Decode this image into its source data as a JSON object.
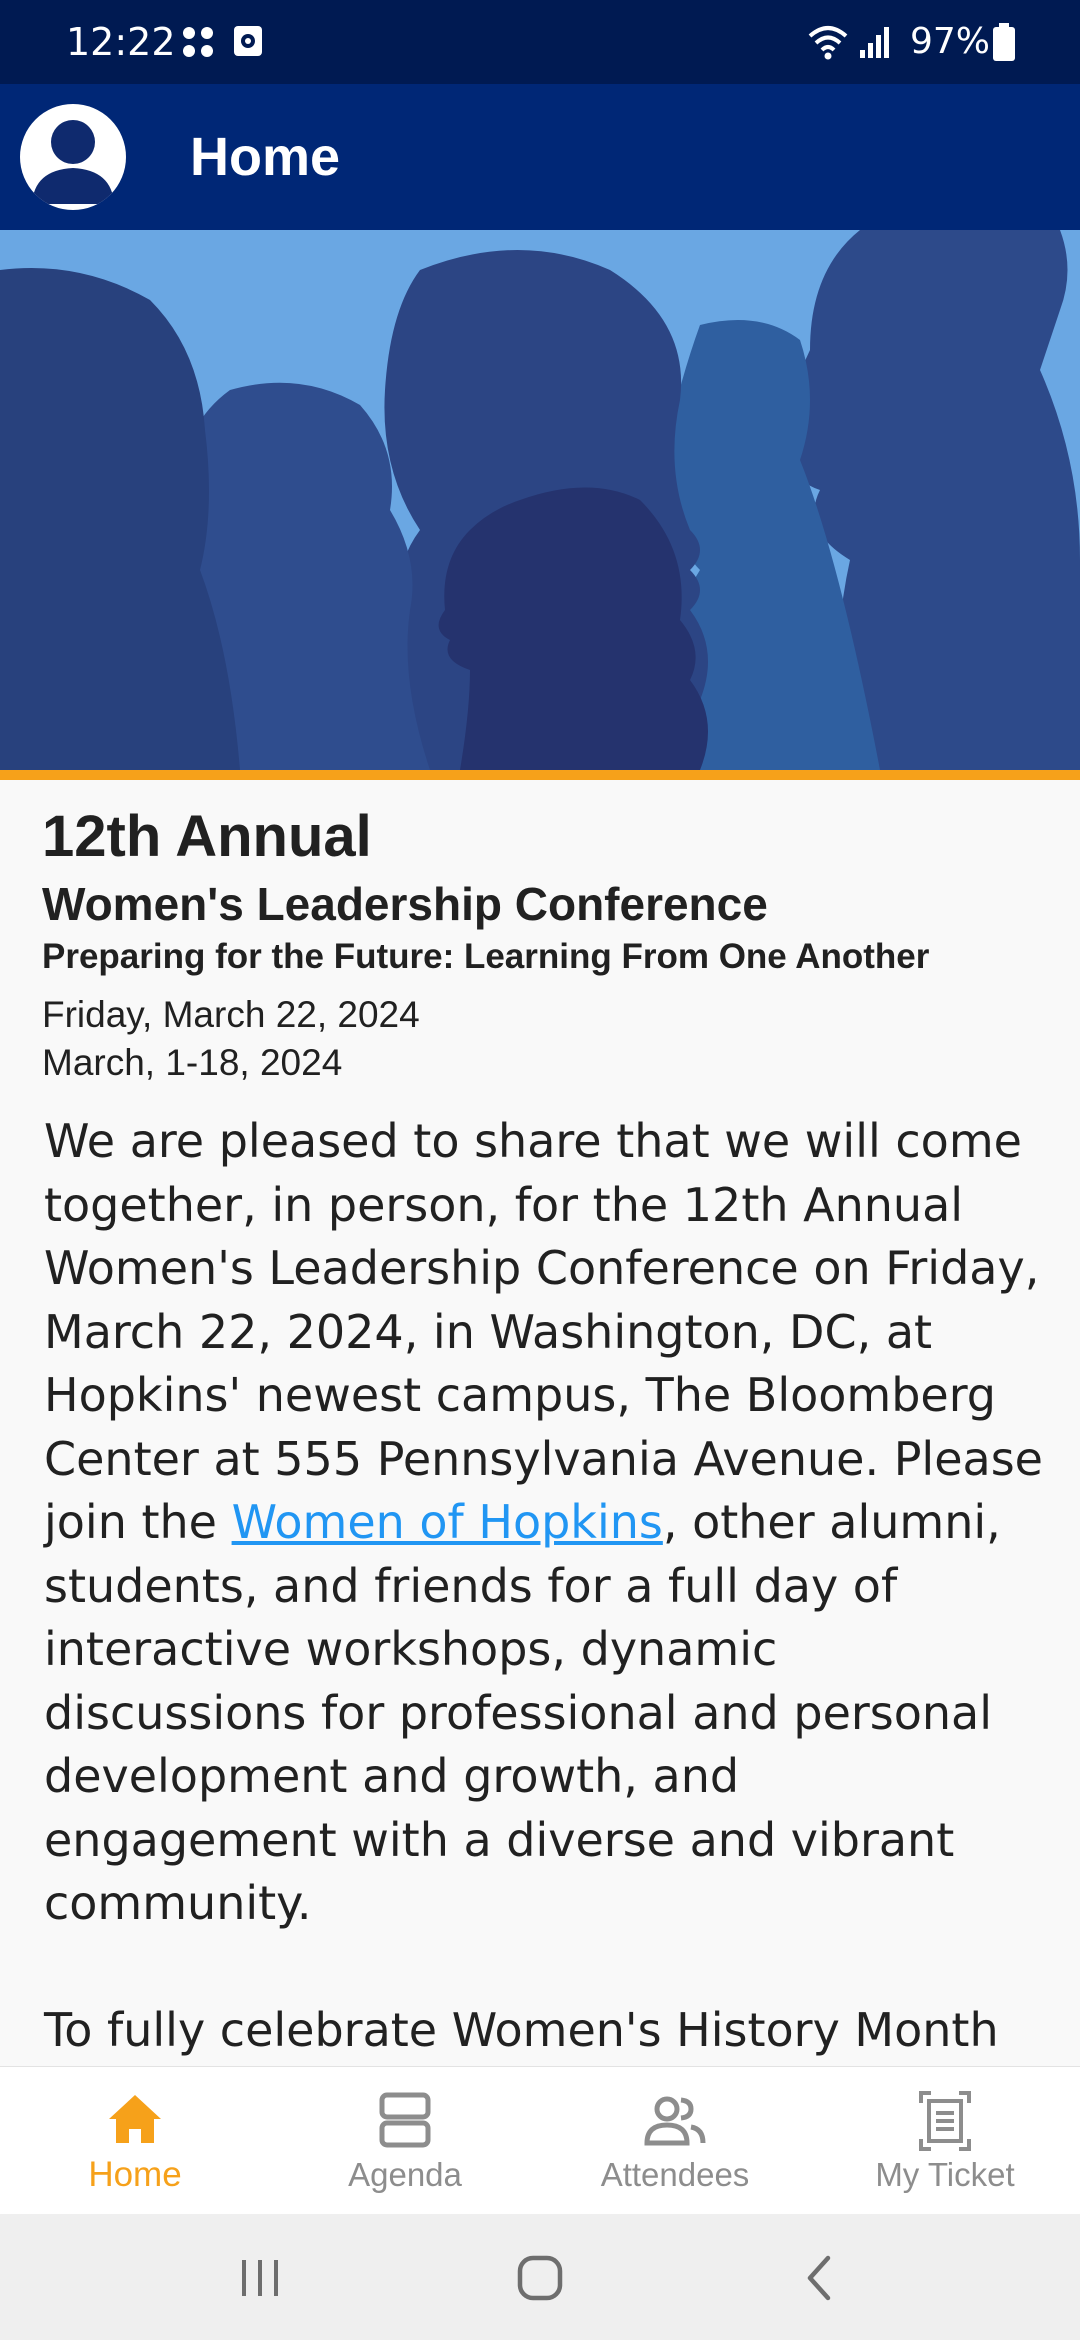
{
  "status_bar": {
    "time": "12:22",
    "battery": "97%",
    "icons": [
      "app-notification-icon",
      "screenshot-icon",
      "wifi-icon",
      "signal-icon",
      "battery-icon"
    ]
  },
  "app_bar": {
    "title": "Home",
    "avatar_icon": "user-avatar-icon"
  },
  "hero": {
    "accent_color": "#f6a11a",
    "background_color": "#6aa7e3"
  },
  "event": {
    "edition": "12th Annual",
    "name": "Women's Leadership Conference",
    "theme": "Preparing for the Future: Learning From One Another",
    "date": "Friday, March 22, 2024",
    "date_range": "March, 1-18, 2024"
  },
  "description": {
    "para1_before_link": "We are pleased to share that we will come together, in person, for the 12th Annual Women's Leadership Conference on Friday, March 22, 2024, in Washington, DC, at Hopkins' newest campus, The Bloomberg Center at 555 Pennsylvania Avenue. Please join the ",
    "para1_link": "Women of Hopkins",
    "para1_after_link": ", other alumni, students, and friends for a full day of interactive workshops, dynamic discussions for professional and personal development and growth, and engagement with a diverse and vibrant community.",
    "para2": "To fully celebrate Women's History Month virtual sessions will be offered in the"
  },
  "bottom_nav": {
    "active_color": "#f6a11a",
    "items": [
      {
        "label": "Home",
        "icon": "home-icon"
      },
      {
        "label": "Agenda",
        "icon": "agenda-icon"
      },
      {
        "label": "Attendees",
        "icon": "attendees-icon"
      },
      {
        "label": "My Ticket",
        "icon": "ticket-icon"
      }
    ]
  },
  "system_nav": {
    "buttons": [
      "recents-icon",
      "home-circle-icon",
      "back-icon"
    ]
  }
}
